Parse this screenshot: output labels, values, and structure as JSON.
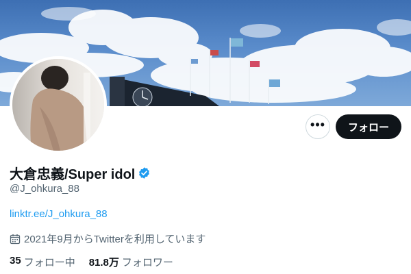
{
  "profile": {
    "name": "大倉忠義/Super idol",
    "handle": "@J_ohkura_88",
    "link": "linktr.ee/J_ohkura_88",
    "joined": "2021年9月からTwitterを利用しています",
    "verified": true
  },
  "actions": {
    "more_label": "•••",
    "follow_label": "フォロー"
  },
  "stats": {
    "following_count": "35",
    "following_label": "フォロー中",
    "followers_count": "81.8万",
    "followers_label": "フォロワー"
  },
  "icons": {
    "verified": "verified-badge-icon",
    "calendar": "calendar-icon",
    "more": "more-icon"
  },
  "colors": {
    "accent": "#1d9bf0",
    "text": "#0f1419",
    "muted": "#536471",
    "follow_button": "#0f1419"
  }
}
